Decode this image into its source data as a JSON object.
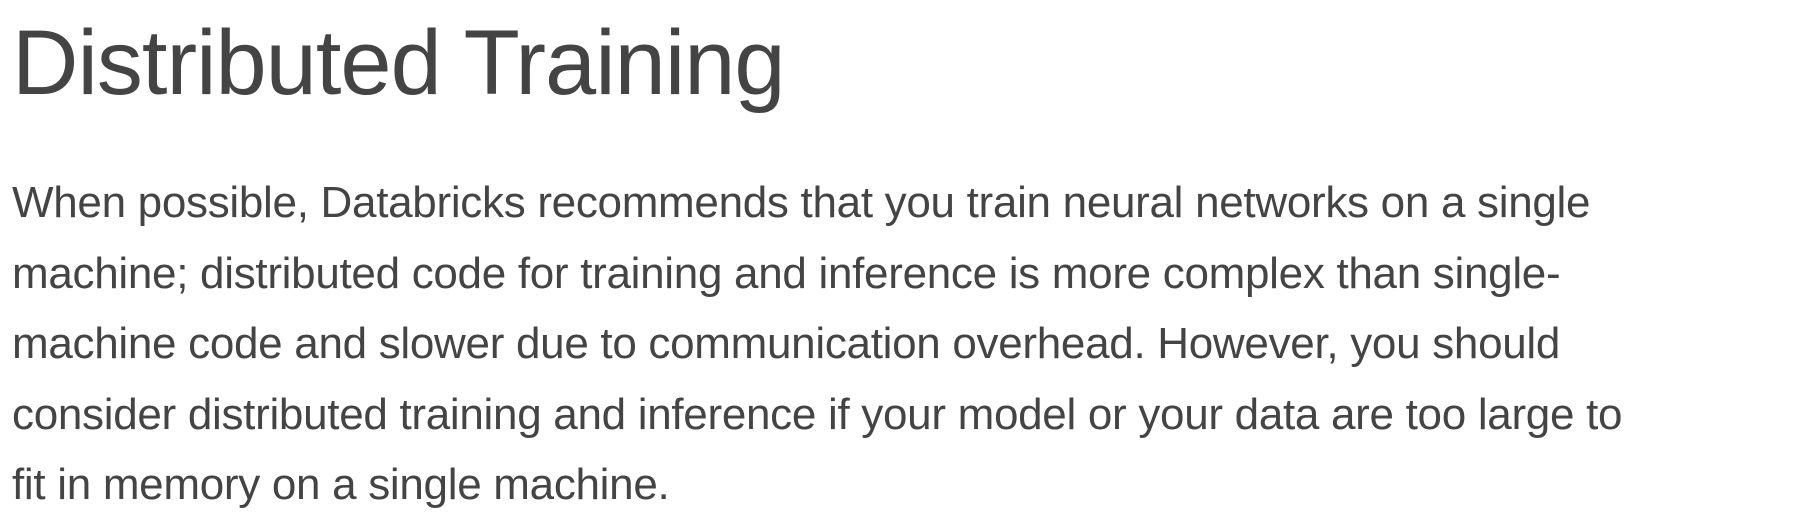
{
  "page": {
    "title": "Distributed Training",
    "paragraph_lines": [
      "When possible, Databricks recommends that you train neural networks on a single",
      "machine; distributed code for training and inference is more complex than single-",
      "machine code and slower due to communication overhead. However, you should",
      "consider distributed training and inference if your model or your data are too large to",
      "fit in memory on a single machine."
    ]
  },
  "colors": {
    "text": "#444444",
    "background": "#ffffff"
  }
}
